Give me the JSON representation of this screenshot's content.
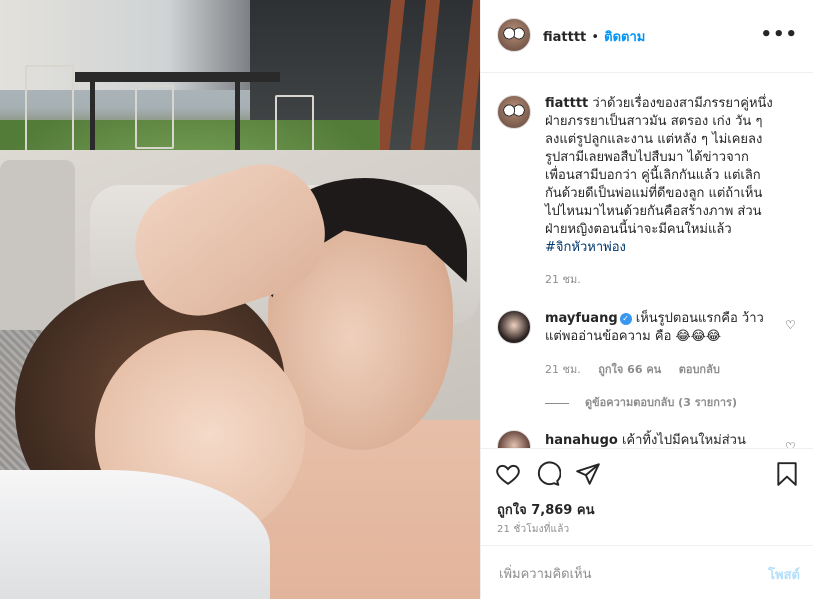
{
  "post": {
    "username": "fiatttt",
    "follow_label": "ติดตาม",
    "more_label": "•••"
  },
  "caption": {
    "username": "fiatttt",
    "text": "ว่าด้วยเรื่องของสามีภรรยาคู่หนึ่ง ฝ่ายภรรยาเป็นสาวมัน สตรอง เก่ง วัน ๆ ลงแต่รูปลูกและงาน แต่หลัง ๆ ไม่เคยลงรูปสามีเลยพอสืบไปสืบมา ได้ข่าวจากเพื่อนสามีบอกว่า คู่นี้เลิกกันแล้ว แต่เลิกกันด้วยดีเป็นพ่อแม่ที่ดีของลูก แต่ถ้าเห็นไปไหนมาไหนด้วยกันคือสร้างภาพ ส่วนฝ่ายหญิงตอนนี้น่าจะมีคนใหม่แล้ว",
    "hashtag": "#จิกหัวหาพ่อง",
    "time": "21 ชม."
  },
  "comments": [
    {
      "username": "mayfuang",
      "verified": true,
      "text": "เห็นรูปตอนแรกคือ ว้าว แต่พออ่านข้อความ คือ 😂😂😂",
      "time": "21 ชม.",
      "likes": "ถูกใจ 66 คน",
      "reply_label": "ตอบกลับ",
      "view_replies": "ดูข้อความตอบกลับ (3 รายการ)"
    },
    {
      "username": "hanahugo",
      "verified": false,
      "text": "เค้าทิ้งไปมีคนใหม่ส่วน"
    }
  ],
  "actions": {
    "like_icon": "heart-icon",
    "comment_icon": "comment-icon",
    "share_icon": "paper-plane-icon",
    "save_icon": "bookmark-icon"
  },
  "likes_text": "ถูกใจ 7,869 คน",
  "timestamp": "21 ชั่วโมงที่แล้ว",
  "composer": {
    "placeholder": "เพิ่มความคิดเห็น",
    "post_label": "โพสต์"
  },
  "colors": {
    "link": "#0095f6",
    "post_disabled": "#b2dffc",
    "hashtag": "#00376b",
    "muted": "#8e8e8e"
  }
}
